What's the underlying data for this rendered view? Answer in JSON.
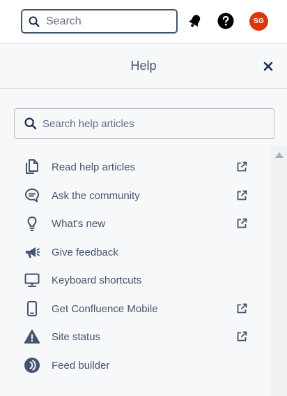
{
  "topbar": {
    "search": {
      "placeholder": "Search",
      "icon": "search-icon"
    },
    "notifications_icon": "bell-icon",
    "help_icon": "question-icon",
    "avatar_initials": "SG",
    "avatar_color": "#de350b"
  },
  "help_panel": {
    "title": "Help",
    "close_icon": "close-icon",
    "search": {
      "placeholder": "Search help articles",
      "icon": "search-icon"
    },
    "items": [
      {
        "label": "Read help articles",
        "icon": "documents-icon",
        "external": true
      },
      {
        "label": "Ask the community",
        "icon": "chat-bubble-icon",
        "external": true
      },
      {
        "label": "What's new",
        "icon": "lightbulb-icon",
        "external": true
      },
      {
        "label": "Give feedback",
        "icon": "megaphone-icon",
        "external": false
      },
      {
        "label": "Keyboard shortcuts",
        "icon": "monitor-icon",
        "external": false
      },
      {
        "label": "Get Confluence Mobile",
        "icon": "mobile-phone-icon",
        "external": true
      },
      {
        "label": "Site status",
        "icon": "warning-icon",
        "external": true
      },
      {
        "label": "Feed builder",
        "icon": "feed-icon",
        "external": false
      }
    ]
  }
}
